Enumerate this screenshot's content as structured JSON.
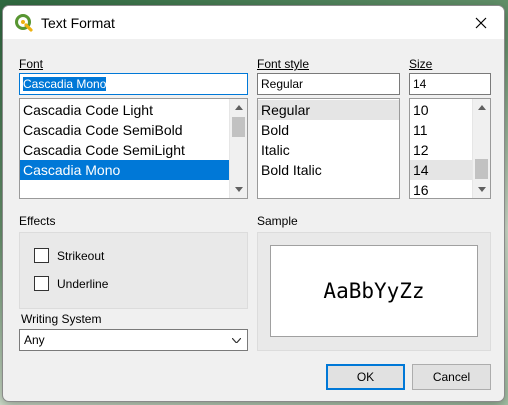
{
  "window": {
    "title": "Text Format"
  },
  "font": {
    "label": "Font",
    "input_value": "Cascadia Mono",
    "items": [
      "Cascadia Code Light",
      "Cascadia Code SemiBold",
      "Cascadia Code SemiLight",
      "Cascadia Mono"
    ],
    "selected": "Cascadia Mono"
  },
  "font_style": {
    "label": "Font style",
    "input_value": "Regular",
    "items": [
      "Regular",
      "Bold",
      "Italic",
      "Bold Italic"
    ],
    "selected": "Regular"
  },
  "size": {
    "label": "Size",
    "input_value": "14",
    "items": [
      "10",
      "11",
      "12",
      "14",
      "16"
    ],
    "selected": "14"
  },
  "effects": {
    "label": "Effects",
    "strikeout": {
      "label": "Strikeout",
      "checked": false
    },
    "underline": {
      "label": "Underline",
      "checked": false
    }
  },
  "writing_system": {
    "label": "Writing System",
    "value": "Any"
  },
  "sample": {
    "label": "Sample",
    "text": "AaBbYyZz"
  },
  "buttons": {
    "ok": "OK",
    "cancel": "Cancel"
  },
  "colors": {
    "accent": "#0078d7",
    "qgis_green": "#5cb85c"
  }
}
